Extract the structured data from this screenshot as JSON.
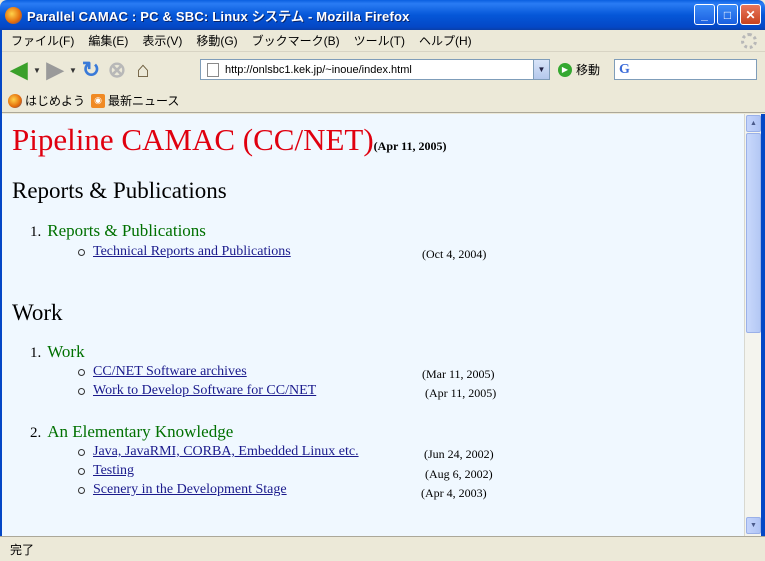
{
  "window": {
    "title": "Parallel CAMAC : PC & SBC: Linux システム - Mozilla Firefox",
    "minimize": "_",
    "maximize": "□",
    "close": "✕"
  },
  "menu": [
    "ファイル(F)",
    "編集(E)",
    "表示(V)",
    "移動(G)",
    "ブックマーク(B)",
    "ツール(T)",
    "ヘルプ(H)"
  ],
  "toolbar": {
    "url": "http://onlsbc1.kek.jp/~inoue/index.html",
    "go_label": "移動",
    "search_value": ""
  },
  "bookmarks": [
    {
      "label": "はじめよう",
      "icon": "firefox-icon"
    },
    {
      "label": "最新ニュース",
      "icon": "rss-icon"
    }
  ],
  "page": {
    "title": "Pipeline CAMAC (CC/NET)",
    "title_date": "(Apr 11, 2005)",
    "sections": [
      {
        "heading": "Reports & Publications",
        "groups": [
          {
            "num": "1.",
            "label": "Reports & Publications",
            "items": [
              {
                "text": "Technical Reports and Publications",
                "date": "(Oct 4, 2004)"
              }
            ]
          }
        ]
      },
      {
        "heading": "Work",
        "groups": [
          {
            "num": "1.",
            "label": "Work",
            "items": [
              {
                "text": "CC/NET Software archives",
                "date": "(Mar 11, 2005)"
              },
              {
                "text": "Work to Develop Software for CC/NET",
                "date": "(Apr 11, 2005)"
              }
            ]
          },
          {
            "num": "2.",
            "label": "An Elementary Knowledge",
            "items": [
              {
                "text": "Java, JavaRMI, CORBA, Embedded Linux etc.",
                "date": "(Jun 24, 2002)"
              },
              {
                "text": "Testing",
                "date": "(Aug 6, 2002)"
              },
              {
                "text": "Scenery in the Development Stage",
                "date": "(Apr 4, 2003)"
              }
            ]
          }
        ]
      }
    ]
  },
  "status": {
    "text": "完了"
  }
}
